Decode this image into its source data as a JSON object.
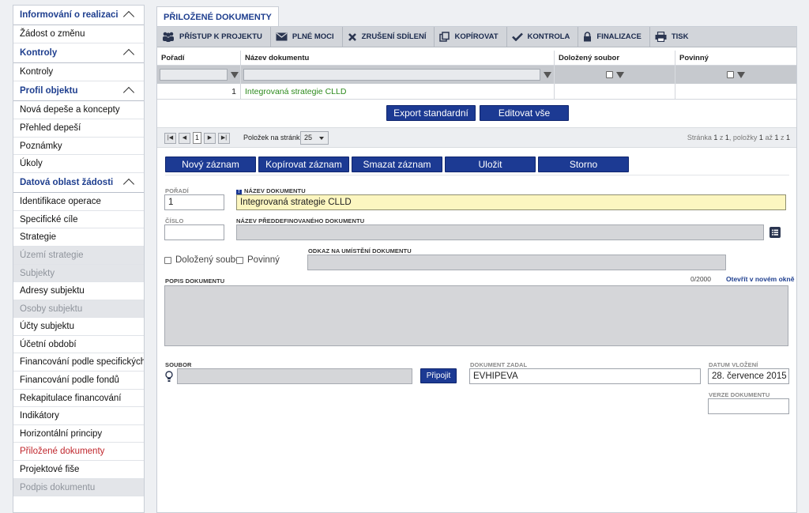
{
  "sidebar": {
    "sections": [
      {
        "title": "Informování o realizaci",
        "items": [
          {
            "label": "Žádost o změnu",
            "state": "normal"
          }
        ]
      },
      {
        "title": "Kontroly",
        "items": [
          {
            "label": "Kontroly",
            "state": "normal"
          }
        ]
      },
      {
        "title": "Profil objektu",
        "items": [
          {
            "label": "Nová depeše a koncepty",
            "state": "normal"
          },
          {
            "label": "Přehled depeší",
            "state": "normal"
          },
          {
            "label": "Poznámky",
            "state": "normal"
          },
          {
            "label": "Úkoly",
            "state": "normal"
          }
        ]
      },
      {
        "title": "Datová oblast žádosti",
        "items": [
          {
            "label": "Identifikace operace",
            "state": "normal"
          },
          {
            "label": "Specifické cíle",
            "state": "normal"
          },
          {
            "label": "Strategie",
            "state": "normal"
          },
          {
            "label": "Území strategie",
            "state": "disabled"
          },
          {
            "label": "Subjekty",
            "state": "disabled"
          },
          {
            "label": "Adresy subjektu",
            "state": "normal"
          },
          {
            "label": "Osoby subjektu",
            "state": "disabled"
          },
          {
            "label": "Účty subjektu",
            "state": "normal"
          },
          {
            "label": "Účetní období",
            "state": "normal"
          },
          {
            "label": "Financování podle specifických cílů",
            "state": "normal"
          },
          {
            "label": "Financování podle fondů",
            "state": "normal"
          },
          {
            "label": "Rekapitulace financování",
            "state": "normal"
          },
          {
            "label": "Indikátory",
            "state": "normal"
          },
          {
            "label": "Horizontální principy",
            "state": "normal"
          },
          {
            "label": "Přiložené dokumenty",
            "state": "active"
          },
          {
            "label": "Projektové fiše",
            "state": "normal"
          },
          {
            "label": "Podpis dokumentu",
            "state": "disabled"
          }
        ]
      }
    ]
  },
  "tab": {
    "title": "PŘILOŽENÉ DOKUMENTY"
  },
  "toolbar": {
    "access": "PŘÍSTUP K PROJEKTU",
    "power": "PLNÉ MOCI",
    "cancel_share": "ZRUŠENÍ SDÍLENÍ",
    "copy": "KOPÍROVAT",
    "check": "KONTROLA",
    "finalize": "FINALIZACE",
    "print": "TISK"
  },
  "grid": {
    "columns": [
      "Pořadí",
      "Název dokumentu",
      "Doložený soubor",
      "Povinný"
    ],
    "rows": [
      {
        "order": "1",
        "name": "Integrovaná strategie CLLD"
      }
    ]
  },
  "actions": {
    "export": "Export standardní",
    "edit_all": "Editovat vše"
  },
  "pager": {
    "current_page": "1",
    "per_page_label": "Položek na stránku",
    "per_page": "25",
    "info_prefix": "Stránka ",
    "info_page": "1",
    "info_of": " z ",
    "info_total_pages": "1",
    "info_items": ", položky ",
    "info_from": "1",
    "info_to_word": " až ",
    "info_to": "1",
    "info_z": " z ",
    "info_total": "1"
  },
  "form_buttons": {
    "new": "Nový záznam",
    "copy": "Kopírovat záznam",
    "delete": "Smazat záznam",
    "save": "Uložit",
    "cancel": "Storno"
  },
  "form": {
    "order_label": "POŘADÍ",
    "order_value": "1",
    "name_label": "NÁZEV DOKUMENTU",
    "name_value": "Integrovaná strategie CLLD",
    "number_label": "ČÍSLO",
    "number_value": "",
    "predef_label": "NÁZEV PŘEDDEFINOVANÉHO DOKUMENTU",
    "predef_value": "",
    "attached_label": "Doložený soubor",
    "mandatory_label": "Povinný",
    "link_label": "ODKAZ NA UMÍSTĚNÍ DOKUMENTU",
    "link_value": "",
    "desc_label": "POPIS DOKUMENTU",
    "desc_counter": "0/2000",
    "open_new_window": "Otevřít v novém okně",
    "file_label": "SOUBOR",
    "file_value": "",
    "attach_button": "Připojit",
    "entered_by_label": "DOKUMENT ZADAL",
    "entered_by_value": "EVHIPEVA",
    "date_label": "DATUM VLOŽENÍ",
    "date_value": "28. července 2015",
    "version_label": "VERZE DOKUMENTU",
    "version_value": ""
  },
  "colors": {
    "accent": "#1c3a93",
    "active_item": "#c0272d",
    "link_green": "#2e8b1e",
    "required_bg": "#fcf6c0"
  }
}
